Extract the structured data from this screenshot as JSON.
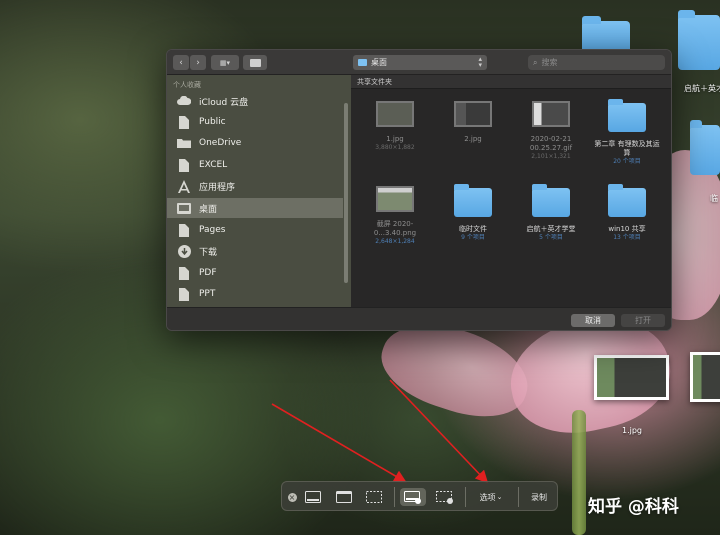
{
  "desktop": {
    "icons": [
      {
        "label": ""
      },
      {
        "label": "启航＋英才"
      },
      {
        "label": ""
      },
      {
        "label": "临"
      }
    ],
    "floating_thumbnails": [
      {
        "label": "1.jpg"
      },
      {
        "label": ""
      }
    ]
  },
  "dialog": {
    "location": "桌面",
    "search_placeholder": "搜索",
    "sidebar": {
      "section_title": "个人收藏",
      "items": [
        {
          "label": "iCloud 云盘",
          "icon": "cloud-icon"
        },
        {
          "label": "Public",
          "icon": "document-icon"
        },
        {
          "label": "OneDrive",
          "icon": "folder-icon"
        },
        {
          "label": "EXCEL",
          "icon": "document-icon"
        },
        {
          "label": "应用程序",
          "icon": "applications-icon"
        },
        {
          "label": "桌面",
          "icon": "desktop-icon",
          "selected": true
        },
        {
          "label": "Pages",
          "icon": "document-icon"
        },
        {
          "label": "下载",
          "icon": "download-icon"
        },
        {
          "label": "PDF",
          "icon": "document-icon"
        },
        {
          "label": "PPT",
          "icon": "document-icon"
        }
      ]
    },
    "main": {
      "header": "共享文件夹",
      "items": [
        {
          "name": "1.jpg",
          "meta": "3,880×1,882",
          "kind": "image",
          "dim": true
        },
        {
          "name": "2.jpg",
          "meta": "",
          "kind": "image",
          "dim": true
        },
        {
          "name": "2020-02-21 00.25.27.gif",
          "meta": "2,101×1,321",
          "kind": "doc",
          "dim": true
        },
        {
          "name": "第二章 有理数及其运算",
          "meta": "20 个项目",
          "kind": "folder",
          "dim": false
        },
        {
          "name": "截屏 2020-0...3.40.png",
          "meta": "2,648×1,284",
          "kind": "shot",
          "dim": true
        },
        {
          "name": "临时文件",
          "meta": "9 个项目",
          "kind": "folder",
          "dim": false
        },
        {
          "name": "启航＋英才学堂",
          "meta": "5 个项目",
          "kind": "folder",
          "dim": false
        },
        {
          "name": "win10 共享",
          "meta": "13 个项目",
          "kind": "folder",
          "dim": false
        }
      ]
    },
    "buttons": {
      "cancel": "取消",
      "open": "打开"
    }
  },
  "capture_toolbar": {
    "options_label": "选项",
    "record_label": "录制"
  },
  "watermark": "知乎 @科科"
}
